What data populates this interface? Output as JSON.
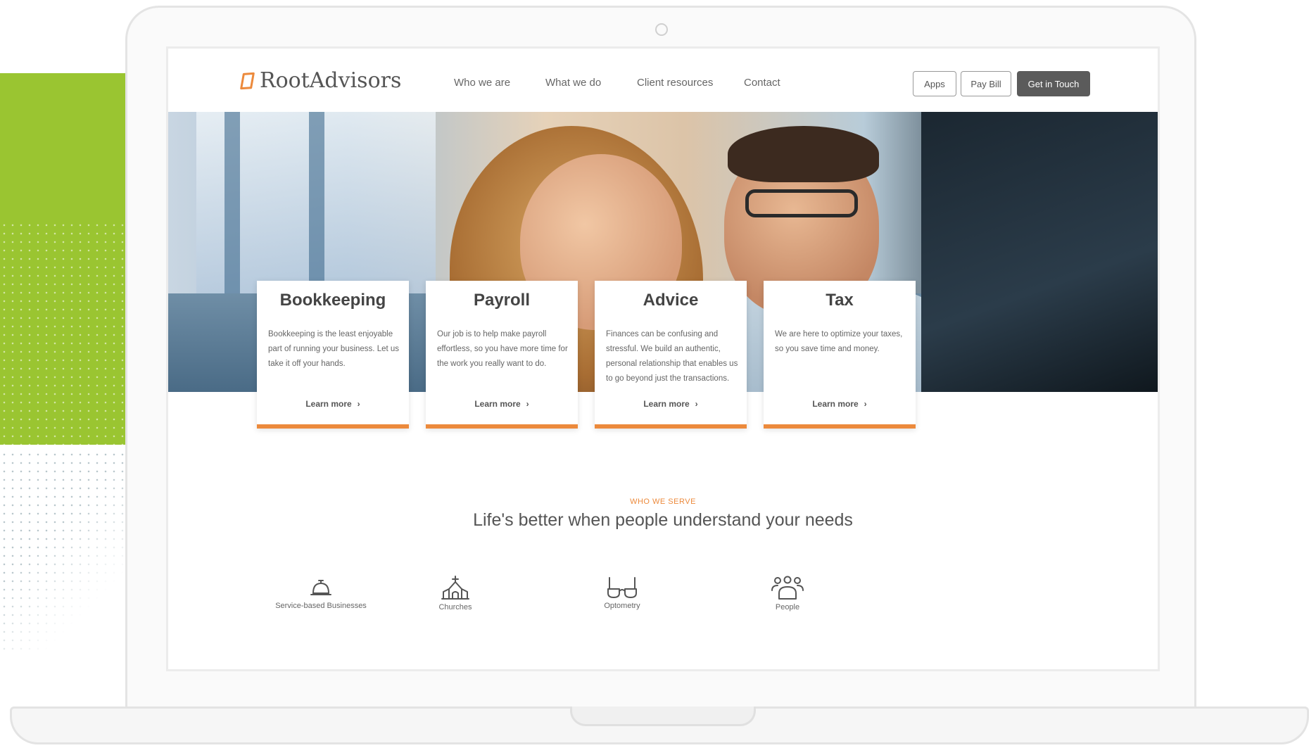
{
  "brand": {
    "name": "RootAdvisors",
    "accent": "#ec8a3c",
    "side_green": "#9ac531"
  },
  "nav": {
    "items": [
      {
        "label": "Who we are"
      },
      {
        "label": "What we do"
      },
      {
        "label": "Client resources"
      },
      {
        "label": "Contact"
      }
    ]
  },
  "header_buttons": {
    "apps": "Apps",
    "pay_bill": "Pay Bill",
    "get_in_touch": "Get in Touch"
  },
  "cards": [
    {
      "title": "Bookkeeping",
      "body": "Bookkeeping is the least enjoyable part of running your business. Let us take it off your hands.",
      "link": "Learn more"
    },
    {
      "title": "Payroll",
      "body": "Our job is to help make payroll effortless, so you have more time for the work you really want to do.",
      "link": "Learn more"
    },
    {
      "title": "Advice",
      "body": "Finances can be confusing and stressful. We build an authentic, personal relationship that enables us to go beyond just the transactions.",
      "link": "Learn more"
    },
    {
      "title": "Tax",
      "body": "We are here to optimize your taxes, so you save time and money.",
      "link": "Learn more"
    }
  ],
  "serve": {
    "eyebrow": "WHO WE SERVE",
    "heading": "Life's better when people understand your needs",
    "items": [
      {
        "label": "Service-based Businesses",
        "icon": "service-bell-icon"
      },
      {
        "label": "Churches",
        "icon": "church-icon"
      },
      {
        "label": "Optometry",
        "icon": "glasses-icon"
      },
      {
        "label": "People",
        "icon": "people-icon"
      }
    ]
  }
}
